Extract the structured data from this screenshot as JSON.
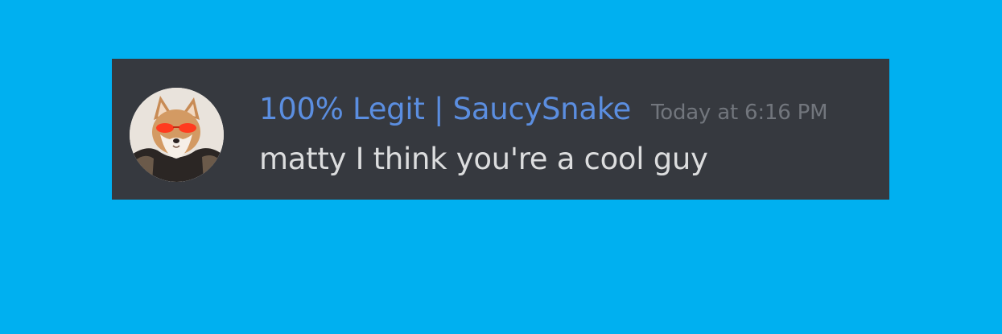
{
  "colors": {
    "page_background": "#00b0f0",
    "message_background": "#36393f",
    "username": "#5b8ee0",
    "timestamp": "#72767d",
    "message_text": "#dcddde"
  },
  "message": {
    "author": "100% Legit | SaucySnake",
    "timestamp": "Today at 6:16 PM",
    "content": "matty I think you're a cool guy",
    "avatar_icon": "shiba-dog-with-red-sunglasses-avatar"
  }
}
